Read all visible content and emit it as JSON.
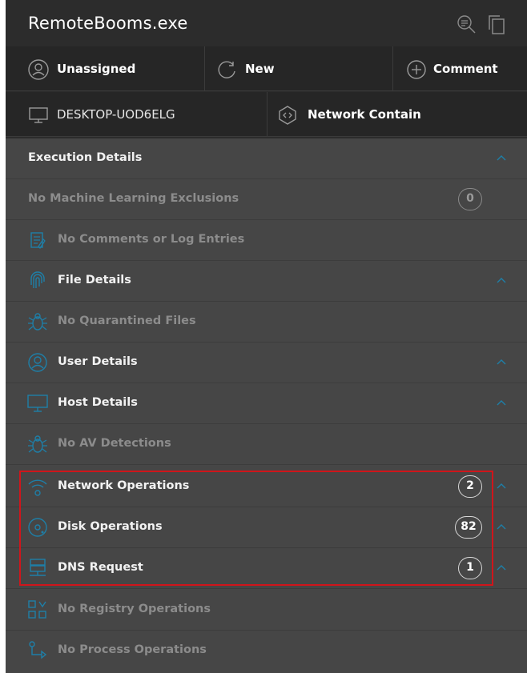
{
  "window": {
    "title": "RemoteBooms.exe"
  },
  "toolbar": {
    "assignee": {
      "label": "Unassigned",
      "icon": "person-icon"
    },
    "status": {
      "label": "New",
      "icon": "refresh-icon"
    },
    "comment": {
      "label": "Comment",
      "icon": "plus-circle-icon"
    },
    "host": {
      "label": "DESKTOP-UOD6ELG",
      "icon": "monitor-icon"
    },
    "contain": {
      "label": "Network Contain",
      "icon": "network-contain-icon"
    }
  },
  "sections": [
    {
      "label": "Execution Details",
      "icon": "",
      "expandable": true,
      "dim": false
    },
    {
      "label": "No Machine Learning Exclusions",
      "icon": "",
      "badge": "0",
      "dim": true
    },
    {
      "label": "No Comments or Log Entries",
      "icon": "notepad-icon",
      "dim": true
    },
    {
      "label": "File Details",
      "icon": "fingerprint-icon",
      "expandable": true,
      "dim": false
    },
    {
      "label": "No Quarantined Files",
      "icon": "bug-icon",
      "dim": true
    },
    {
      "label": "User Details",
      "icon": "person-icon",
      "expandable": true,
      "dim": false
    },
    {
      "label": "Host Details",
      "icon": "monitor-icon",
      "expandable": true,
      "dim": false
    },
    {
      "label": "No AV Detections",
      "icon": "bug-icon",
      "dim": true
    },
    {
      "label": "Network Operations",
      "icon": "wifi-icon",
      "badge": "2",
      "expandable": true,
      "dim": false
    },
    {
      "label": "Disk Operations",
      "icon": "disk-icon",
      "badge": "82",
      "expandable": true,
      "dim": false
    },
    {
      "label": "DNS Request",
      "icon": "dns-icon",
      "badge": "1",
      "expandable": true,
      "dim": false
    },
    {
      "label": "No Registry Operations",
      "icon": "registry-icon",
      "dim": true
    },
    {
      "label": "No Process Operations",
      "icon": "process-icon",
      "dim": true
    }
  ],
  "colors": {
    "accent": "#1e7fa8",
    "highlight": "#d0151b",
    "panel": "#464646",
    "header": "#262626"
  }
}
